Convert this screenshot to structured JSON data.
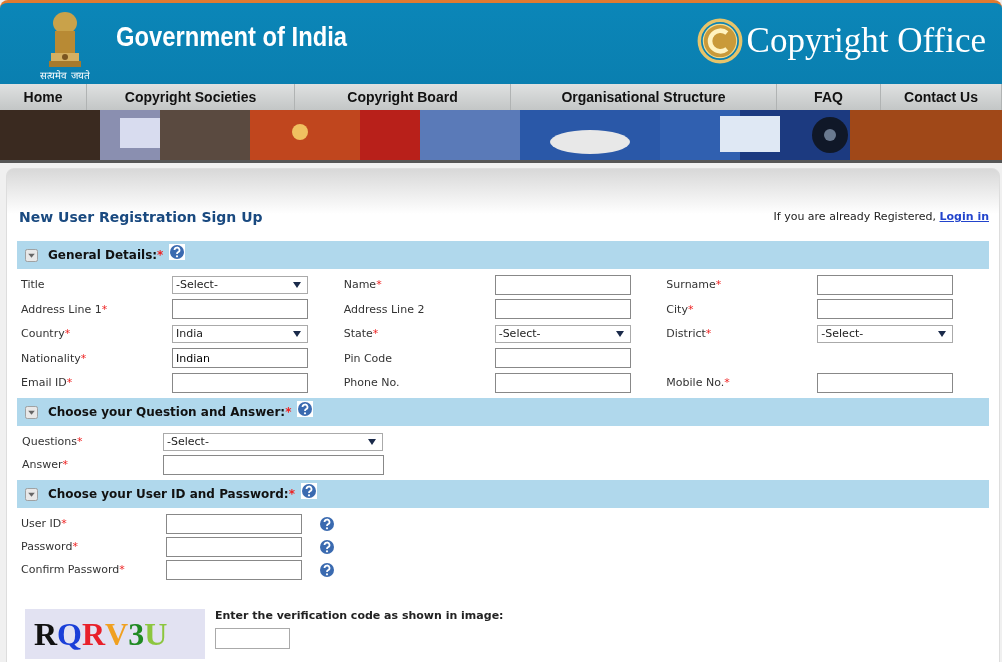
{
  "header": {
    "emblem_motto": "सत्यमेव जयते",
    "government": "Government of India",
    "office": "Copyright Office"
  },
  "nav": [
    {
      "label": "Home"
    },
    {
      "label": "Copyright Societies"
    },
    {
      "label": "Copyright Board"
    },
    {
      "label": "Organisational Structure"
    },
    {
      "label": "FAQ"
    },
    {
      "label": "Contact Us"
    }
  ],
  "page_title": "New User Registration Sign Up",
  "login_prompt": {
    "text": "If you are already Registered,",
    "link": "Login in"
  },
  "sections": [
    {
      "title": "General Details:",
      "asterisk": "*",
      "expanded": true,
      "kind": "grid",
      "rows": [
        [
          {
            "label": "Title",
            "kind": "select",
            "value": "-Select-"
          },
          {
            "label": "Name",
            "asterisk": "*",
            "kind": "text"
          },
          {
            "label": "Surname",
            "asterisk": "*",
            "kind": "text"
          }
        ],
        [
          {
            "label": "Address Line 1",
            "asterisk": "*",
            "kind": "text"
          },
          {
            "label": "Address Line 2",
            "kind": "text"
          },
          {
            "label": "City",
            "asterisk": "*",
            "kind": "text"
          }
        ],
        [
          {
            "label": "Country",
            "asterisk": "*",
            "kind": "select",
            "value": "India"
          },
          {
            "label": "State",
            "asterisk": "*",
            "kind": "select",
            "value": "-Select-"
          },
          {
            "label": "District",
            "asterisk": "*",
            "kind": "select",
            "value": "-Select-"
          }
        ],
        [
          {
            "label": "Nationality",
            "asterisk": "*",
            "kind": "text",
            "value": "Indian"
          },
          {
            "label": "Pin Code",
            "kind": "text"
          }
        ],
        [
          {
            "label": "Email ID",
            "asterisk": "*",
            "kind": "text"
          },
          {
            "label": "Phone No.",
            "kind": "text"
          },
          {
            "label": "Mobile No.",
            "asterisk": "*",
            "kind": "text"
          }
        ]
      ]
    },
    {
      "title": "Choose your Question and Answer:",
      "asterisk": "*",
      "expanded": true,
      "kind": "wide",
      "rows": [
        [
          {
            "label": "Questions",
            "asterisk": "*",
            "kind": "select",
            "value": "-Select-"
          }
        ],
        [
          {
            "label": "Answer",
            "asterisk": "*",
            "kind": "text"
          }
        ]
      ]
    },
    {
      "title": "Choose your User ID and Password:",
      "asterisk": "*",
      "expanded": true,
      "kind": "help",
      "rows": [
        [
          {
            "label": "User ID",
            "asterisk": "*",
            "kind": "text"
          }
        ],
        [
          {
            "label": "Password",
            "asterisk": "*",
            "kind": "text"
          }
        ],
        [
          {
            "label": "Confirm Password",
            "asterisk": "*",
            "kind": "text"
          }
        ]
      ]
    }
  ],
  "captcha": {
    "letters": [
      {
        "char": "R",
        "color": "#111111"
      },
      {
        "char": "Q",
        "color": "#1a3fd8"
      },
      {
        "char": "R",
        "color": "#e8202a"
      },
      {
        "char": "V",
        "color": "#f0a020"
      },
      {
        "char": "3",
        "color": "#1f8a22"
      },
      {
        "char": "U",
        "color": "#8cc63f"
      }
    ],
    "prompt": "Enter the verification code as shown in image:"
  }
}
